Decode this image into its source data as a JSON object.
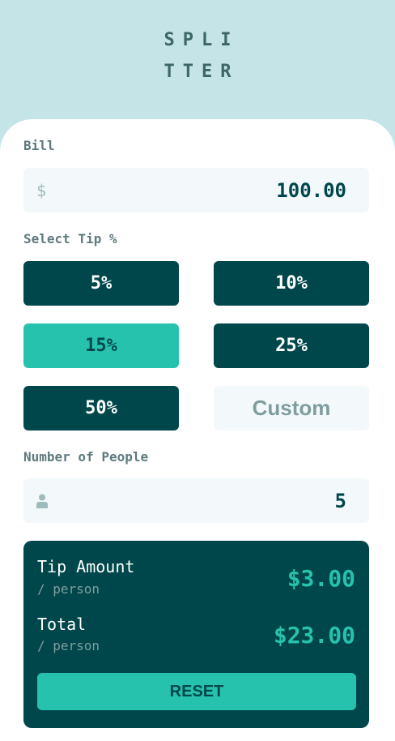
{
  "logo": {
    "line1": "SPLI",
    "line2": "TTER"
  },
  "bill": {
    "label": "Bill",
    "prefix_symbol": "$",
    "value": "100.00"
  },
  "tip": {
    "label": "Select Tip %",
    "options": [
      "5%",
      "10%",
      "15%",
      "25%",
      "50%"
    ],
    "selected": "15%",
    "custom_placeholder": "Custom"
  },
  "people": {
    "label": "Number of People",
    "icon": "person-icon",
    "value": "5"
  },
  "result": {
    "tip_title": "Tip Amount",
    "tip_sub": "/ person",
    "tip_value": "$3.00",
    "total_title": "Total",
    "total_sub": "/ person",
    "total_value": "$23.00",
    "reset_label": "RESET"
  },
  "colors": {
    "background": "#c5e4e7",
    "dark_cyan": "#00474b",
    "strong_cyan": "#26c2ad",
    "input_bg": "#f3f9fa",
    "label_gray": "#5e7a7d"
  }
}
